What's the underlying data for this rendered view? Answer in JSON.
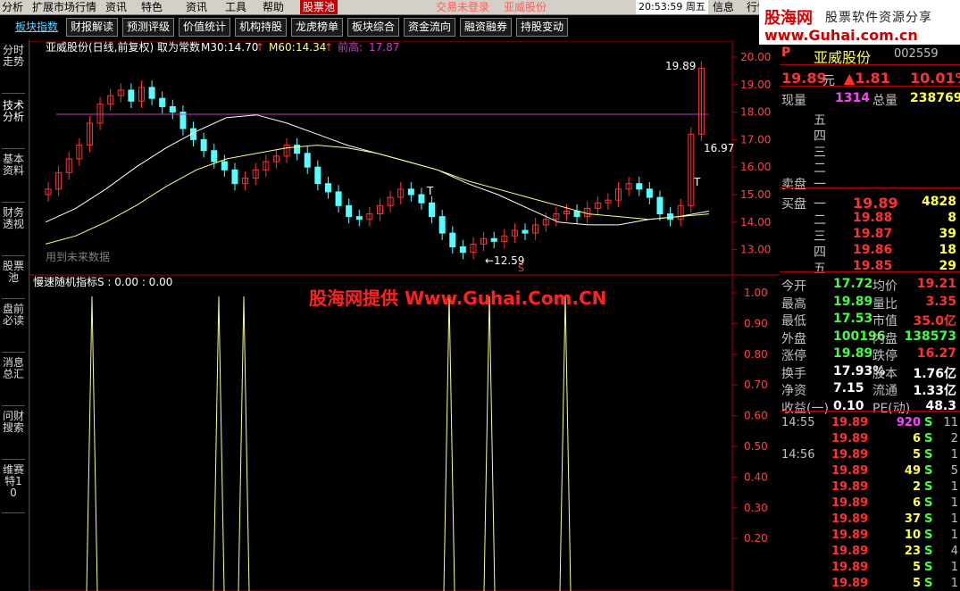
{
  "menu": {
    "items": [
      "分析",
      "扩展市场行情",
      "资讯",
      "特色",
      "资讯",
      "工具",
      "帮助"
    ],
    "selected": "股票池",
    "status1": "交易未登录",
    "status2": "亚威股份",
    "clock": "20:53:59 周五",
    "info": "信息",
    "row": "行情"
  },
  "toolbar": [
    "板块指数",
    "财报解读",
    "预测评级",
    "价值统计",
    "机构持股",
    "龙虎榜单",
    "板块综合",
    "资金流向",
    "融资融券",
    "持股变动"
  ],
  "banner": {
    "logo": "股海网",
    "slogan": "股票软件资源分享",
    "url": "www.Guhai.com.cn"
  },
  "left_tabs": [
    "分时走势",
    "技术分析",
    "基本资料",
    "财务透视",
    "股票池",
    "盘前必读",
    "消息总汇",
    "问财搜索",
    "维赛特10"
  ],
  "chart": {
    "title": "亚威股份(日线,前复权) 取为常数",
    "ma30_label": "M30:",
    "ma30": "14.70",
    "ma60_label": "M60:",
    "ma60": "14.34",
    "prev_high_label": "前高:",
    "prev_high": "17.87",
    "price_high_mark": "19.89",
    "price_low_mark": "16.97",
    "low_mark": "←12.59",
    "T1": "T",
    "T2": "T",
    "S1": "S",
    "future_note": "用到未来数据",
    "up_marks": [
      "↑",
      "↑"
    ],
    "y_ticks": [
      "20.00",
      "19.00",
      "18.00",
      "17.00",
      "16.00",
      "15.00",
      "14.00",
      "13.00"
    ],
    "indicator_title": "慢速随机指标S : 0.00 : 0.00",
    "ind_ticks": [
      "1.00",
      "0.90",
      "0.80",
      "0.70",
      "0.60",
      "0.50",
      "0.40",
      "0.30",
      "0.20"
    ],
    "watermark": "股海网提供 Www.Guhai.Com.CN"
  },
  "panel": {
    "p_letter": "P",
    "name": "亚威股份",
    "code": "002559",
    "price": "19.89",
    "yuan": "元",
    "change": "▲1.81",
    "pct": "10.01%",
    "xianliang_label": "现量",
    "xianliang": "1314",
    "zongliang_label": "总量",
    "zongliang": "238769",
    "sell_labels": [
      "五",
      "四",
      "三",
      "二",
      "一"
    ],
    "sell_title": "卖盘",
    "buy_title": "买盘",
    "buy_rows": [
      {
        "lvl": "一",
        "price": "19.89",
        "vol": "4828"
      },
      {
        "lvl": "二",
        "price": "19.88",
        "vol": "8"
      },
      {
        "lvl": "三",
        "price": "19.87",
        "vol": "39"
      },
      {
        "lvl": "四",
        "price": "19.86",
        "vol": "18"
      },
      {
        "lvl": "五",
        "price": "19.85",
        "vol": "29"
      }
    ],
    "stats": [
      {
        "l1": "今开",
        "v1": "17.72",
        "l2": "均价",
        "v2": "19.21"
      },
      {
        "l1": "最高",
        "v1": "19.89",
        "l2": "量比",
        "v2": "3.35"
      },
      {
        "l1": "最低",
        "v1": "17.53",
        "l2": "市值",
        "v2": "35.0亿"
      },
      {
        "l1": "外盘",
        "v1": "100196",
        "l2": "内盘",
        "v2": "138573"
      },
      {
        "l1": "涨停",
        "v1": "19.89",
        "l2": "跌停",
        "v2": "16.27"
      },
      {
        "l1": "换手",
        "v1": "17.93%",
        "l2": "股本",
        "v2": "1.76亿"
      },
      {
        "l1": "净资",
        "v1": "7.15",
        "l2": "流通",
        "v2": "1.33亿"
      },
      {
        "l1": "收益(一)",
        "v1": "0.10",
        "l2": "PE(动)",
        "v2": "48.3"
      }
    ],
    "ticks": [
      {
        "t": "14:55",
        "p": "19.89",
        "v": "920",
        "s": "S",
        "n": "11"
      },
      {
        "t": "",
        "p": "19.89",
        "v": "6",
        "s": "S",
        "n": "2"
      },
      {
        "t": "14:56",
        "p": "19.89",
        "v": "5",
        "s": "S",
        "n": "1"
      },
      {
        "t": "",
        "p": "19.89",
        "v": "49",
        "s": "S",
        "n": "5"
      },
      {
        "t": "",
        "p": "19.89",
        "v": "2",
        "s": "S",
        "n": "1"
      },
      {
        "t": "",
        "p": "19.89",
        "v": "6",
        "s": "S",
        "n": "1"
      },
      {
        "t": "",
        "p": "19.89",
        "v": "37",
        "s": "S",
        "n": "1"
      },
      {
        "t": "",
        "p": "19.89",
        "v": "10",
        "s": "S",
        "n": "1"
      },
      {
        "t": "",
        "p": "19.89",
        "v": "23",
        "s": "S",
        "n": "4"
      },
      {
        "t": "",
        "p": "19.89",
        "v": "5",
        "s": "S",
        "n": "1"
      },
      {
        "t": "",
        "p": "19.89",
        "v": "5",
        "s": "S",
        "n": "1"
      }
    ]
  },
  "colors": {
    "up": "#ff3030",
    "down": "#54ffff",
    "ma30": "#ffffff",
    "ma60": "#ffff80",
    "resistance": "#c040c0",
    "axis": "#b00000"
  }
}
